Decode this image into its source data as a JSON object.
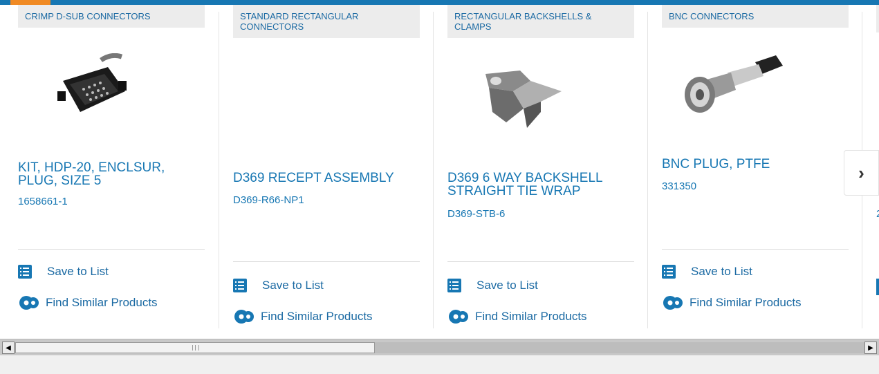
{
  "colors": {
    "accent": "#1777b3",
    "orange": "#f08a24",
    "tab_bg": "#ececec"
  },
  "cards": [
    {
      "category": "CRIMP D-SUB CONNECTORS",
      "title": "KIT, HDP-20, ENCLSUR, PLUG, SIZE 5",
      "part_number": "1658661-1",
      "image": "d-sub-plug-cable",
      "save_label": "Save to List",
      "similar_label": "Find Similar Products"
    },
    {
      "category": "STANDARD RECTANGULAR CONNECTORS",
      "title": "D369 RECEPT ASSEMBLY",
      "part_number": "D369-R66-NP1",
      "image": "none",
      "save_label": "Save to List",
      "similar_label": "Find Similar Products"
    },
    {
      "category": "RECTANGULAR BACKSHELLS & CLAMPS",
      "title": "D369 6 WAY BACKSHELL STRAIGHT TIE WRAP",
      "part_number": "D369-STB-6",
      "image": "metal-backshell",
      "save_label": "Save to List",
      "similar_label": "Find Similar Products"
    },
    {
      "category": "BNC CONNECTORS",
      "title": "BNC PLUG, PTFE",
      "part_number": "331350",
      "image": "bnc-plug",
      "save_label": "Save to List",
      "similar_label": "Find Similar Products"
    }
  ],
  "partial_card": {
    "part_number_fragment": "2"
  },
  "navigation": {
    "next_icon": "chevron-right-icon"
  },
  "scrollbar": {
    "left_arrow": "◀",
    "right_arrow": "▶"
  }
}
